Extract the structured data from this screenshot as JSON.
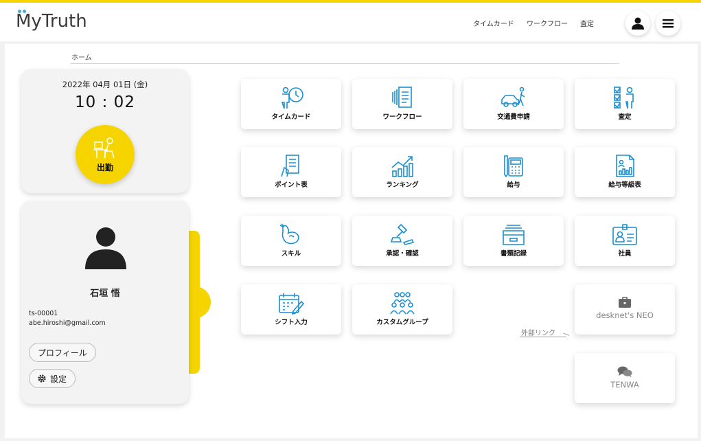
{
  "header": {
    "logo_text": "MyTruth",
    "nav": [
      "タイムカード",
      "ワークフロー",
      "査定"
    ],
    "accent_color": "#f5d400"
  },
  "breadcrumb": "ホーム",
  "clock": {
    "date": "2022年 04月 01日 (金)",
    "time": "10 : 02",
    "clock_in_label": "出勤"
  },
  "profile": {
    "name": "石垣 悟",
    "user_id": "ts-00001",
    "email": "abe.hiroshi@gmail.com",
    "profile_button": "プロフィール",
    "settings_button": "設定"
  },
  "tiles": [
    {
      "label": "タイムカード",
      "icon": "timecard-icon"
    },
    {
      "label": "ワークフロー",
      "icon": "workflow-icon"
    },
    {
      "label": "交通費申請",
      "icon": "transport-icon"
    },
    {
      "label": "査定",
      "icon": "evaluation-icon"
    },
    {
      "label": "ポイント表",
      "icon": "points-icon"
    },
    {
      "label": "ランキング",
      "icon": "ranking-icon"
    },
    {
      "label": "給与",
      "icon": "salary-icon"
    },
    {
      "label": "給与等級表",
      "icon": "salary-grade-icon"
    },
    {
      "label": "スキル",
      "icon": "skill-icon"
    },
    {
      "label": "承認・確認",
      "icon": "approval-icon"
    },
    {
      "label": "書類記録",
      "icon": "document-box-icon"
    },
    {
      "label": "社員",
      "icon": "employee-icon"
    },
    {
      "label": "シフト入力",
      "icon": "calendar-icon"
    },
    {
      "label": "カスタムグループ",
      "icon": "group-icon"
    }
  ],
  "external_links_label": "外部リンク",
  "external_links": [
    {
      "label": "desknet's NEO",
      "icon": "briefcase-icon"
    },
    {
      "label": "TENWA",
      "icon": "chat-icon"
    }
  ],
  "icon_color": "#1a8fd1"
}
